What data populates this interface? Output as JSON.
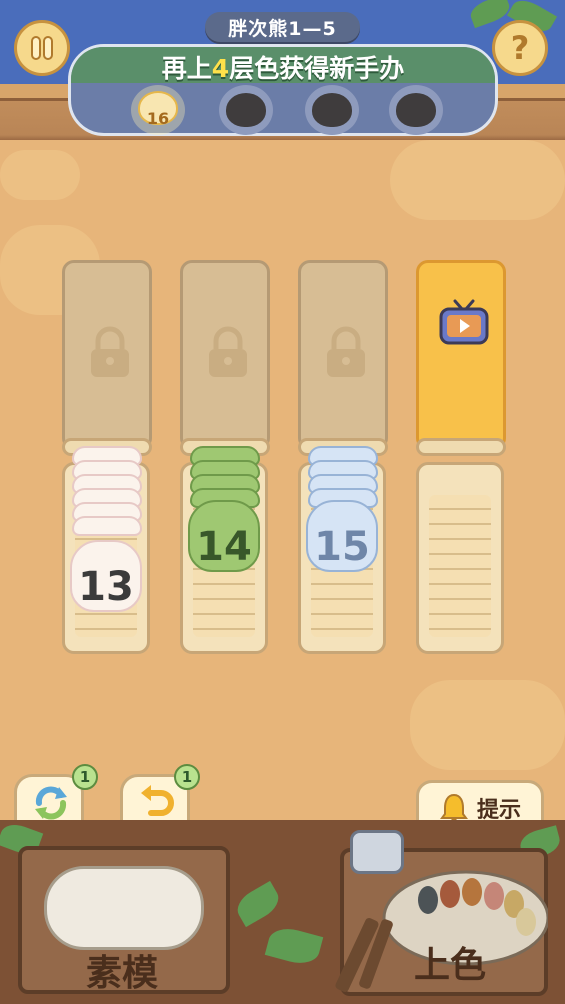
{
  "header": {
    "level_title": "胖次熊1—5",
    "goal_prefix": "再上",
    "goal_number": "4",
    "goal_suffix": "层色获得新手办",
    "first_reward_count": "16"
  },
  "columns": [
    {
      "count": "13"
    },
    {
      "count": "14"
    },
    {
      "count": "15"
    }
  ],
  "actions": {
    "reset_label": "重置",
    "reset_badge": "1",
    "undo_label": "返回",
    "undo_badge": "1",
    "hint_label": "提示"
  },
  "bottom": {
    "left_label": "素模",
    "right_label": "上色"
  },
  "colors": {
    "accent_yellow": "#f8c14a",
    "goal_number": "#ffe14a",
    "white_bear": "#fbf3ec",
    "green_bear": "#9fc872",
    "blue_bear": "#d6e4f5"
  }
}
